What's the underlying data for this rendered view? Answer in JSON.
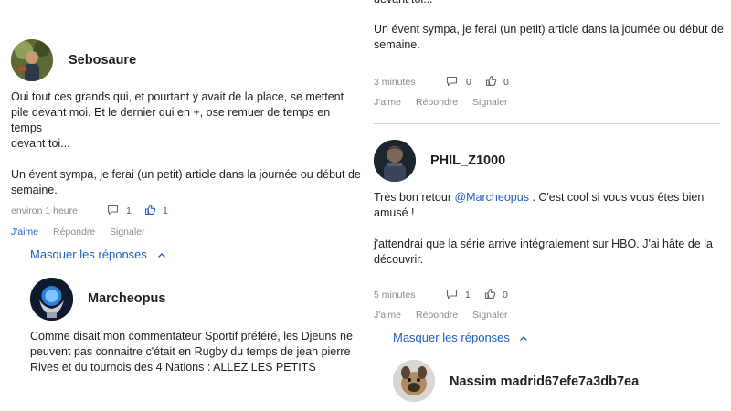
{
  "left": {
    "comment": {
      "username": "Sebosaure",
      "text_lines": [
        "Oui tout ces grands qui, et pourtant y avait de la place, se mettent",
        "pile devant moi. Et le dernier qui en +, ose remuer de temps en temps",
        "devant toi...",
        "",
        "Un évent sympa, je ferai (un petit) article dans la journée ou début de",
        "semaine."
      ],
      "time": "environ 1 heure",
      "comment_count": "1",
      "like_count": "1",
      "actions": {
        "like": "J'aime",
        "reply": "Répondre",
        "report": "Signaler"
      }
    },
    "toggle_label": "Masquer les réponses",
    "reply": {
      "username": "Marcheopus",
      "text_lines": [
        "Comme disait mon commentateur Sportif préféré, les Djeuns ne",
        "peuvent pas connaitre c'était en Rugby du temps de jean pierre",
        "Rives et du tournois des 4 Nations : ALLEZ LES PETITS"
      ]
    }
  },
  "right": {
    "top_comment": {
      "partial_line": "devant toi...",
      "text_lines": [
        "Un évent sympa, je ferai (un petit) article dans la journée ou début de",
        "semaine."
      ],
      "time": "3 minutes",
      "comment_count": "0",
      "like_count": "0",
      "actions": {
        "like": "J'aime",
        "reply": "Répondre",
        "report": "Signaler"
      }
    },
    "comment": {
      "username": "PHIL_Z1000",
      "line1_before": "Très bon retour ",
      "line1_mention": "@Marcheopus",
      "line1_after": " . C'est cool si vous vous êtes bien",
      "line2": "amusé !",
      "line3": "j'attendrai que la série arrive intégralement sur HBO. J'ai hâte de la",
      "line4": "découvrir.",
      "time": "5 minutes",
      "comment_count": "1",
      "like_count": "0",
      "actions": {
        "like": "J'aime",
        "reply": "Répondre",
        "report": "Signaler"
      }
    },
    "toggle_label": "Masquer les réponses",
    "reply": {
      "username": "Nassim madrid67efe7a3db7ea"
    }
  },
  "colors": {
    "link_blue": "#1f5fbf",
    "meta_gray": "#8a8a8a",
    "divider": "#d0d0d0"
  }
}
